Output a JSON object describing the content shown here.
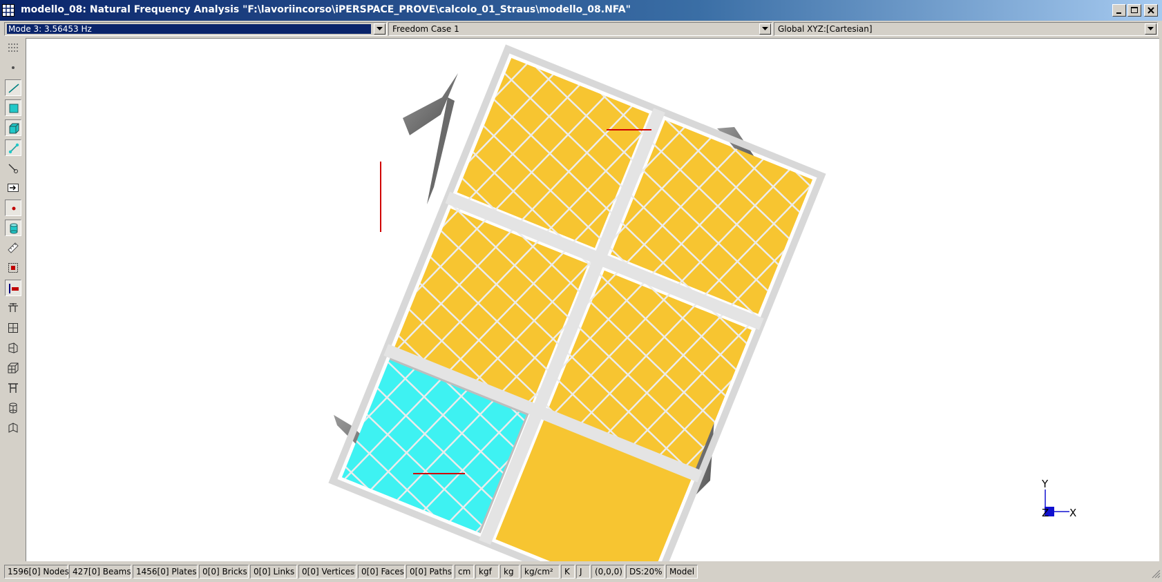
{
  "window": {
    "title": "modello_08: Natural Frequency Analysis \"F:\\lavoriincorso\\iPERSPACE_PROVE\\calcolo_01_Straus\\modello_08.NFA\"",
    "icons": [
      "app-grid-icon",
      "minimize-icon",
      "maximize-icon",
      "close-icon"
    ]
  },
  "selectors": {
    "mode": "Mode 3: 3.56453 Hz",
    "freedom_case": "Freedom Case 1",
    "coordinate_system": "Global XYZ:[Cartesian]"
  },
  "toolbar": {
    "tools": [
      {
        "name": "grid-dots-icon",
        "pressed": false
      },
      {
        "name": "node-icon",
        "pressed": false
      },
      {
        "name": "beam-icon",
        "pressed": true
      },
      {
        "name": "plate-icon",
        "pressed": true
      },
      {
        "name": "brick-icon",
        "pressed": true
      },
      {
        "name": "link-icon",
        "pressed": true
      },
      {
        "name": "pen-icon",
        "pressed": false
      },
      {
        "name": "arrow-box-icon",
        "pressed": false
      },
      {
        "name": "red-dot-icon",
        "pressed": true
      },
      {
        "name": "cylinder-icon",
        "pressed": true
      },
      {
        "name": "ruler-icon",
        "pressed": false
      },
      {
        "name": "fit-view-icon",
        "pressed": false
      },
      {
        "name": "section-icon",
        "pressed": true
      },
      {
        "name": "table-icon",
        "pressed": false
      },
      {
        "name": "grid-icon",
        "pressed": false
      },
      {
        "name": "perspective-icon",
        "pressed": false
      },
      {
        "name": "cube-grid-icon",
        "pressed": false
      },
      {
        "name": "frame-icon",
        "pressed": false
      },
      {
        "name": "cylinder-wire-icon",
        "pressed": false
      },
      {
        "name": "rotate-icon",
        "pressed": false
      }
    ]
  },
  "viewport": {
    "colors": {
      "plate": "#f7c531",
      "plate_selected": "#3ef2f2",
      "beam": "#c4c4c4",
      "shell_dark": "#707070",
      "axis": "#1010d0"
    },
    "axes": {
      "y_label": "Y",
      "z_label": "Z",
      "x_label": "X"
    }
  },
  "status": {
    "nodes": "1596[0] Nodes",
    "beams": "427[0] Beams",
    "plates": "1456[0] Plates",
    "bricks": "0[0] Bricks",
    "links": "0[0] Links",
    "vertices": "0[0] Vertices",
    "faces": "0[0] Faces",
    "paths": "0[0] Paths",
    "unit_length": "cm",
    "unit_force": "kgf",
    "unit_mass": "kg",
    "unit_pressure": "kg/cm²",
    "unit_temp": "K",
    "unit_energy": "J",
    "origin": "(0,0,0)",
    "ds": "DS:20%",
    "view": "Model"
  }
}
